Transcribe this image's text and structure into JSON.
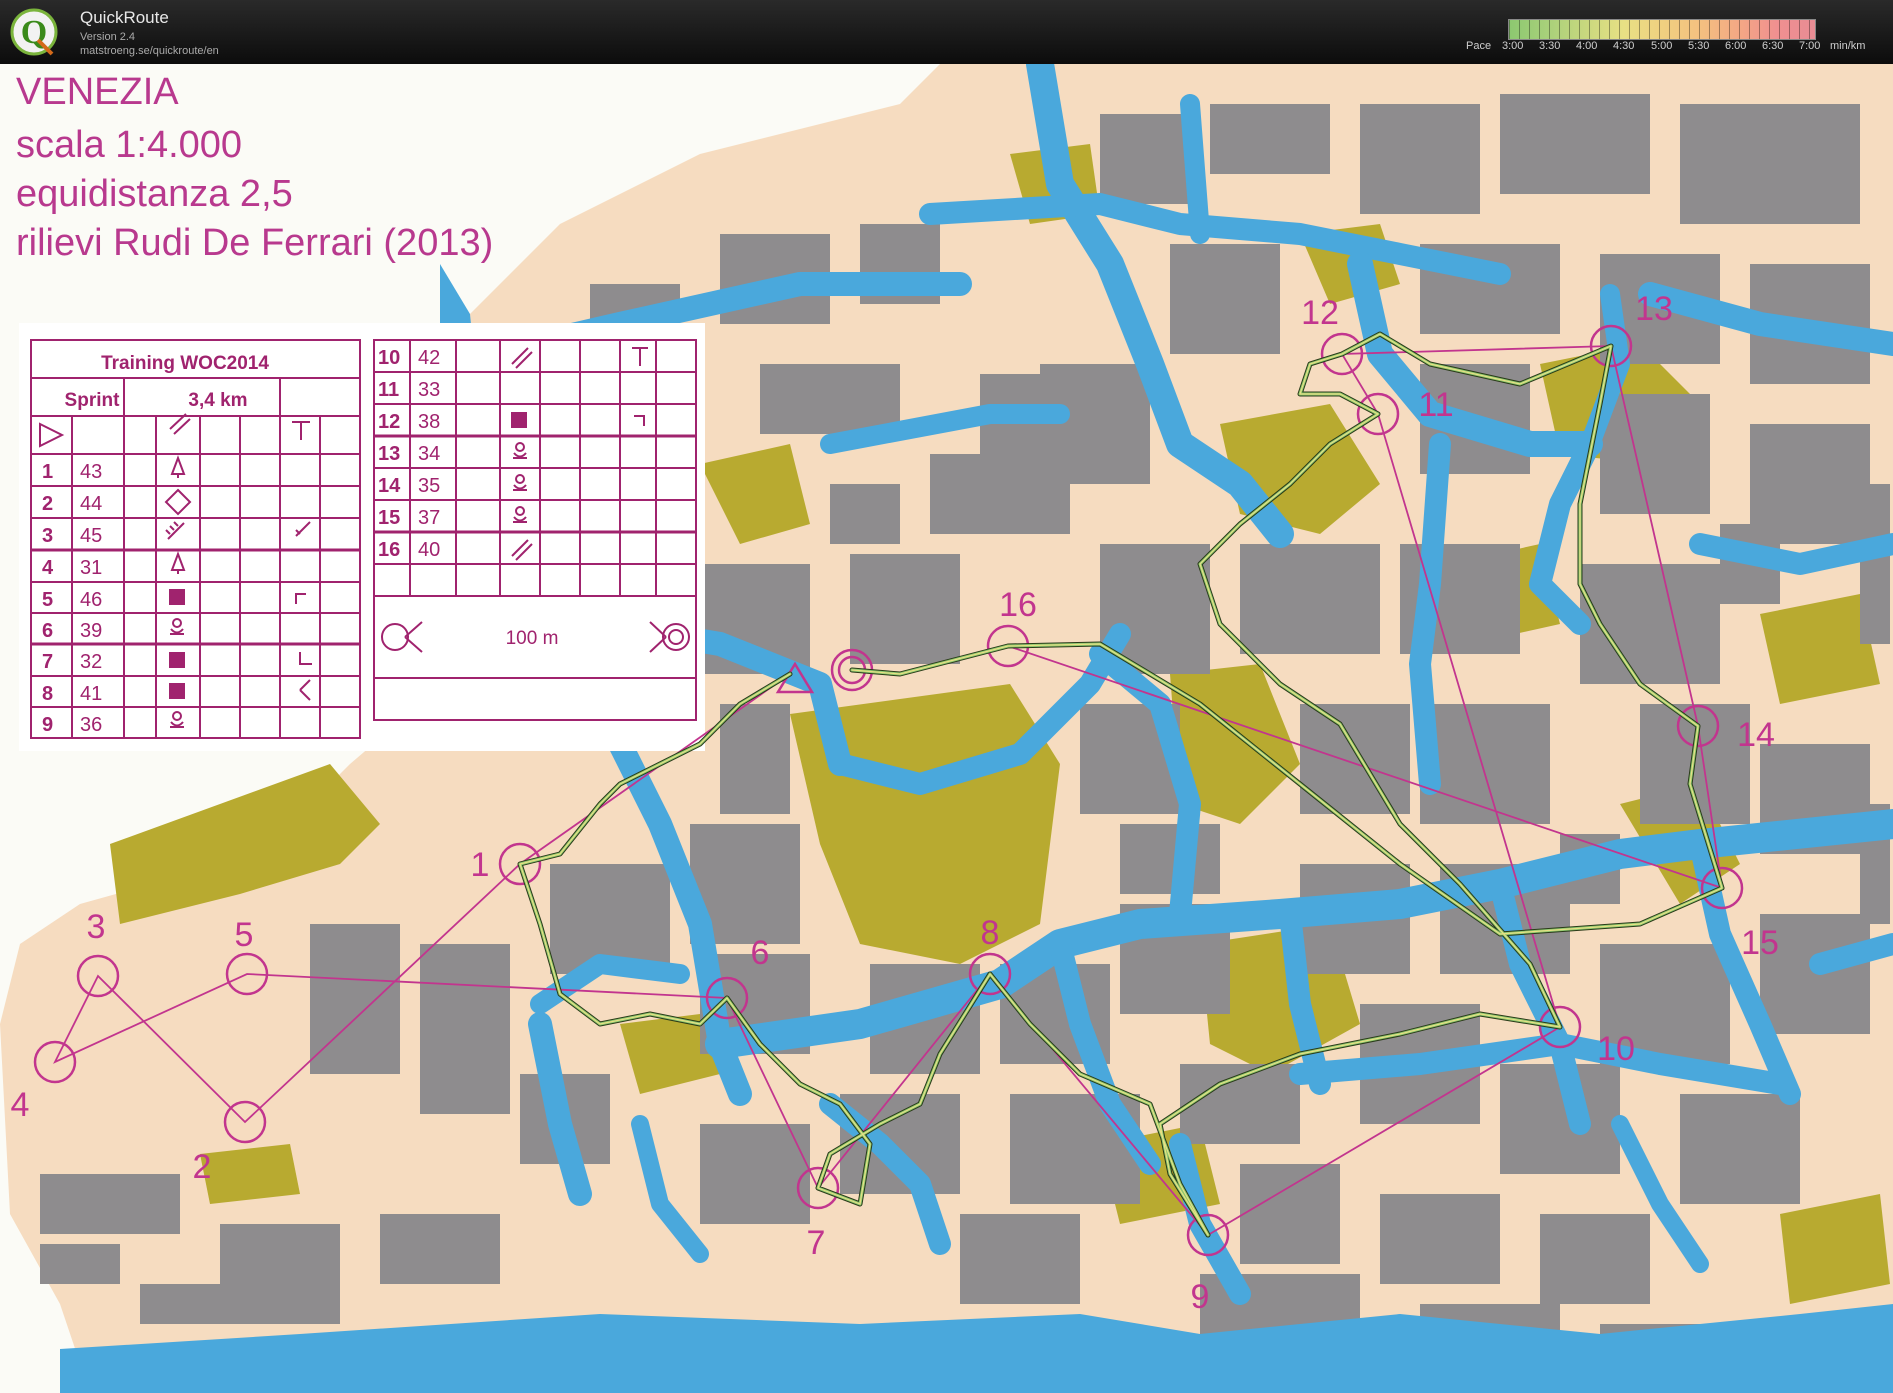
{
  "app": {
    "title": "QuickRoute",
    "version": "Version 2.4",
    "url": "matstroeng.se/quickroute/en",
    "logo_letter": "Q"
  },
  "pace_scale": {
    "prefix": "Pace",
    "labels": [
      "3:00",
      "3:30",
      "4:00",
      "4:30",
      "5:00",
      "5:30",
      "6:00",
      "6:30",
      "7:00"
    ],
    "unit": "min/km",
    "colors": [
      "#8cc870",
      "#c8d87e",
      "#f0d080",
      "#f4a884",
      "#e88c94"
    ]
  },
  "map": {
    "title_lines": [
      "VENEZIA",
      "scala 1:4.000",
      "equidistanza 2,5",
      "rilievi Rudi De Ferrari (2013)"
    ],
    "colors": {
      "paper": "#f6dcc0",
      "water": "#4aa8dc",
      "building": "#8e8c8e",
      "court": "#b8aa30",
      "course": "#c2358e",
      "route": "#2a3a18"
    },
    "description": {
      "event": "Training WOC2014",
      "class": "Sprint",
      "length": "3,4 km",
      "rows": [
        {
          "num": "1",
          "code": "43"
        },
        {
          "num": "2",
          "code": "44"
        },
        {
          "num": "3",
          "code": "45"
        },
        {
          "num": "4",
          "code": "31"
        },
        {
          "num": "5",
          "code": "46"
        },
        {
          "num": "6",
          "code": "39"
        },
        {
          "num": "7",
          "code": "32"
        },
        {
          "num": "8",
          "code": "41"
        },
        {
          "num": "9",
          "code": "36"
        },
        {
          "num": "10",
          "code": "42"
        },
        {
          "num": "11",
          "code": "33"
        },
        {
          "num": "12",
          "code": "38"
        },
        {
          "num": "13",
          "code": "34"
        },
        {
          "num": "14",
          "code": "35"
        },
        {
          "num": "15",
          "code": "37"
        },
        {
          "num": "16",
          "code": "40"
        }
      ],
      "finish_distance": "100 m"
    },
    "controls": [
      {
        "label": "1"
      },
      {
        "label": "2"
      },
      {
        "label": "3"
      },
      {
        "label": "4"
      },
      {
        "label": "5"
      },
      {
        "label": "6"
      },
      {
        "label": "7"
      },
      {
        "label": "8"
      },
      {
        "label": "9"
      },
      {
        "label": "10"
      },
      {
        "label": "11"
      },
      {
        "label": "12"
      },
      {
        "label": "13"
      },
      {
        "label": "14"
      },
      {
        "label": "15"
      },
      {
        "label": "16"
      }
    ]
  }
}
